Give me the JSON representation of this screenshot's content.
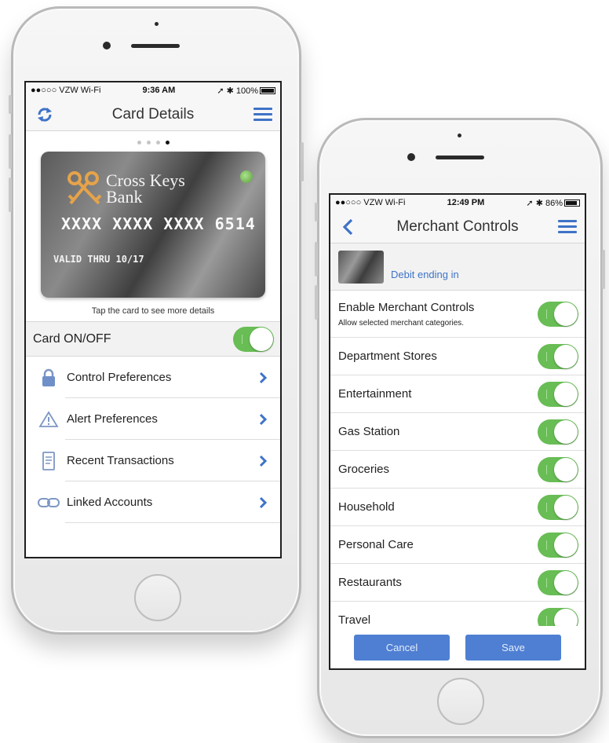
{
  "phone1": {
    "status": {
      "carrier": "●●○○○ VZW Wi-Fi",
      "time": "9:36 AM",
      "battery": "100%"
    },
    "nav": {
      "title": "Card Details"
    },
    "card": {
      "bank_name_line1": "Cross Keys",
      "bank_name_line2": "Bank",
      "number": "XXXX XXXX XXXX 6514",
      "valid": "VALID THRU 10/17"
    },
    "card_hint": "Tap the card to see more details",
    "card_toggle": {
      "label": "Card ON/OFF",
      "on": true
    },
    "menu": [
      {
        "label": "Control Preferences",
        "icon": "lock-icon"
      },
      {
        "label": "Alert Preferences",
        "icon": "alert-icon"
      },
      {
        "label": "Recent Transactions",
        "icon": "receipt-icon"
      },
      {
        "label": "Linked Accounts",
        "icon": "link-icon"
      }
    ]
  },
  "phone2": {
    "status": {
      "carrier": "●●○○○ VZW Wi-Fi",
      "time": "12:49 PM",
      "battery": "86%"
    },
    "nav": {
      "title": "Merchant Controls"
    },
    "debit": "Debit ending in",
    "enable": {
      "label": "Enable Merchant Controls",
      "sub": "Allow selected merchant categories.",
      "on": true
    },
    "categories": [
      {
        "label": "Department Stores",
        "on": true
      },
      {
        "label": "Entertainment",
        "on": true
      },
      {
        "label": "Gas Station",
        "on": true
      },
      {
        "label": "Groceries",
        "on": true
      },
      {
        "label": "Household",
        "on": true
      },
      {
        "label": "Personal Care",
        "on": true
      },
      {
        "label": "Restaurants",
        "on": true
      },
      {
        "label": "Travel",
        "on": true
      }
    ],
    "buttons": {
      "cancel": "Cancel",
      "save": "Save"
    }
  },
  "colors": {
    "accent": "#3e73c7",
    "toggle_on": "#68bd55",
    "button": "#4f7fd2"
  }
}
